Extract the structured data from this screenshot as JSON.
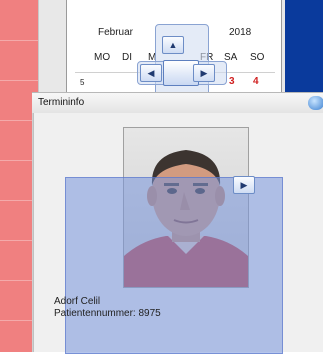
{
  "calendar": {
    "month": "Februar",
    "year": "2018",
    "weekdays": [
      "MO",
      "DI",
      "M",
      "FR",
      "SA",
      "SO"
    ],
    "week_number": "5",
    "day_sa": "3",
    "day_so": "4"
  },
  "window": {
    "title": "Termininfo"
  },
  "patient": {
    "name": "Adorf Celil",
    "id_text": "Patientennummer: 8975"
  },
  "icons": {
    "dock_up": "▲",
    "dock_left": "◀",
    "dock_right": "▶",
    "dock_down": "▼",
    "dock_side_right": "▶"
  },
  "colors": {
    "left_strip": "#f08080",
    "right_blue": "#0a3a9c",
    "overlay": "#7896dc"
  }
}
